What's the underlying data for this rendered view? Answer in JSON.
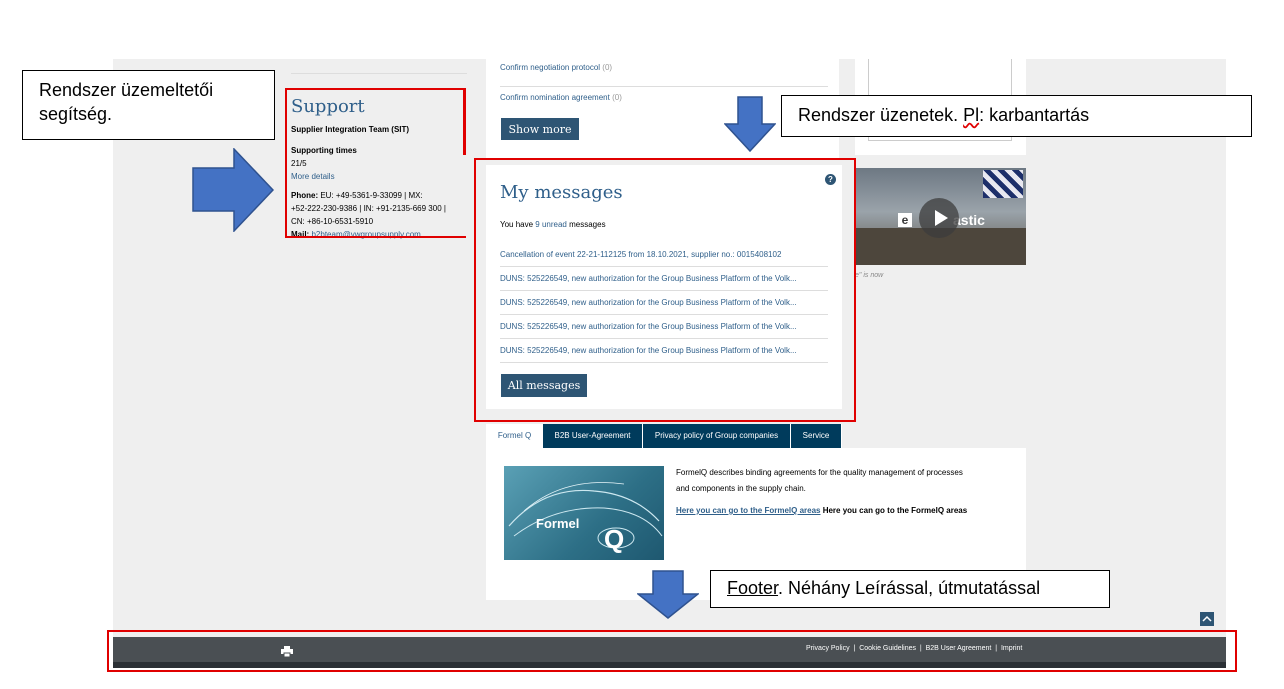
{
  "support": {
    "title": "Support",
    "team": "Supplier Integration Team (SIT)",
    "supporting_times_label": "Supporting times",
    "supporting_times_value": "21/5",
    "more_details": "More details",
    "phone_label": "Phone:",
    "phone_line1": " EU: +49-5361-9-33099 | MX:",
    "phone_line2": "+52-222-230-9386 | IN: +91-2135-669 300 |",
    "phone_line3": "CN: +86-10-6531-5910",
    "mail_label": "Mail:",
    "mail_value": "b2bteam@vwgroupsupply.com"
  },
  "top_list": {
    "item1": "Confirm negotiation protocol",
    "item1_count": "(0)",
    "item2": "Confirm nomination agreement",
    "item2_count": "(0)",
    "show_more": "Show more"
  },
  "messages": {
    "title": "My messages",
    "help": "?",
    "unread_prefix": "You have ",
    "unread_link": "9 unread",
    "unread_suffix": " messages",
    "items": [
      "Cancellation of event 22-21-112125 from 18.10.2021, supplier no.: 0015408102",
      "DUNS: 525226549, new authorization for the Group Business Platform of the Volk...",
      "DUNS: 525226549, new authorization for the Group Business Platform of the Volk...",
      "DUNS: 525226549, new authorization for the Group Business Platform of the Volk...",
      "DUNS: 525226549, new authorization for the Group Business Platform of the Volk..."
    ],
    "all_button": "All messages"
  },
  "video": {
    "title_part1": "e",
    "title_part2": "astic",
    "caption": "e\" is now"
  },
  "tabs": [
    "Formel Q",
    "B2B User-Agreement",
    "Privacy policy of Group companies",
    "Service"
  ],
  "formelq": {
    "text_line1": "FormelQ describes binding agreements for the quality management of processes",
    "text_line2": "and components in the supply chain.",
    "link": "Here you can go to the FormelQ areas",
    "bold_text": " Here you can go to the FormelQ areas",
    "image_text_a": "Formel",
    "image_text_b": "Q"
  },
  "footer": {
    "links": [
      "Privacy Policy",
      "Cookie Guidelines",
      "B2B User Agreement",
      "Imprint"
    ],
    "separator": "|"
  },
  "callouts": {
    "left_line1": "Rendszer üzemeltetői",
    "left_line2": "segítség.",
    "right_prefix": "Rendszer üzenetek. ",
    "right_underlined": "Pl",
    "right_suffix": ": karbantartás",
    "footer_underlined": "Footer",
    "footer_suffix": ". Néhány Leírással, útmutatással"
  },
  "colors": {
    "annotation_red": "#e00000",
    "arrow_blue": "#4472c4",
    "button_blue": "#2e5574",
    "tab_blue": "#003b5c",
    "footer_gray": "#4a4f53"
  }
}
